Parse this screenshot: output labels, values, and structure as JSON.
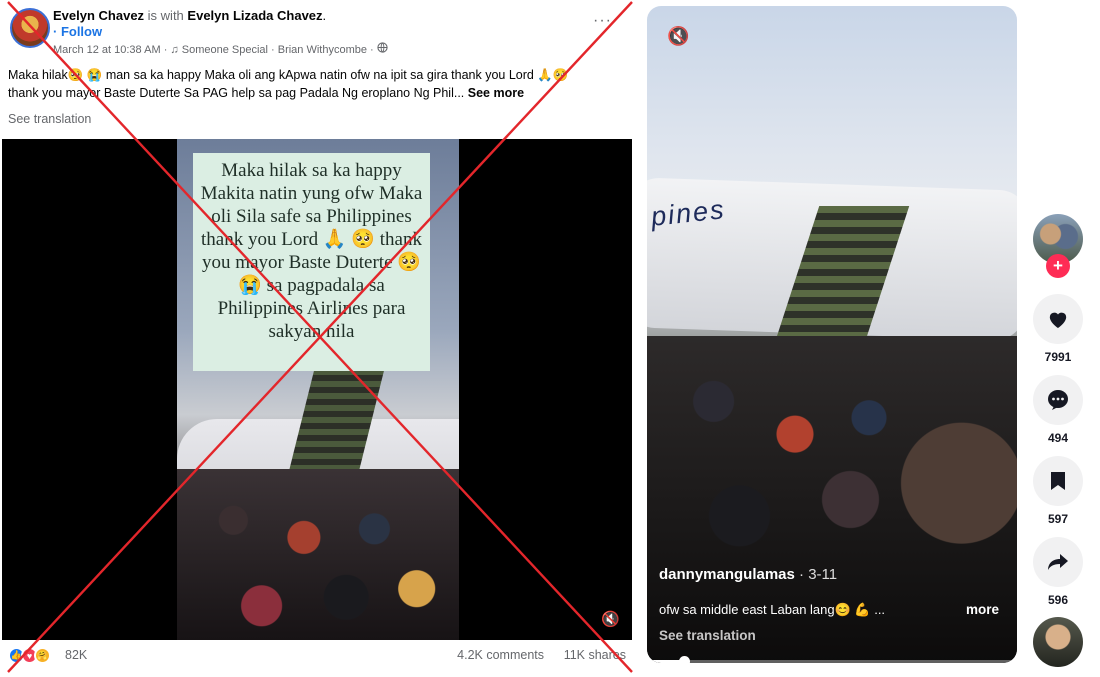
{
  "facebook_post": {
    "author": "Evelyn Chavez",
    "with_text": "is with",
    "tagged": "Evelyn Lizada Chavez",
    "tagged_suffix": ".",
    "follow": "· Follow",
    "timestamp": "March 12 at 10:38 AM",
    "meta_sep": "·",
    "audio": "Someone Special · Brian Withycombe",
    "privacy_icon": "globe-icon",
    "more_icon": "···",
    "caption_line1": "Maka hilak🥺 😭 man sa ka happy Maka oli ang kApwa natin ofw na ipit sa gira thank you Lord 🙏🥺",
    "caption_line2": "thank you mayor Baste Duterte Sa PAG help sa pag Padala Ng eroplano Ng Phil...",
    "see_more": "See more",
    "see_translation": "See translation",
    "video_overlay_text": "Maka hilak sa ka happy Makita natin yung ofw Maka oli Sila safe sa Philippines thank you Lord 🙏 🥺  thank you mayor Baste Duterte 🥺😭 sa pagpadala  sa Philippines Airlines para sakyan nila",
    "mute_icon": "🔇",
    "reactions": [
      "like",
      "love",
      "care"
    ],
    "reaction_count": "82K",
    "comments": "4.2K comments",
    "shares": "11K shares",
    "false_mark_color": "#e3262b"
  },
  "tiktok": {
    "mute_icon": "🔇",
    "airline_text": "pines",
    "username": "dannymangulamas",
    "date": " · 3-11",
    "caption": "ofw sa middle east Laban lang😊 💪 ...",
    "more": "more",
    "see_translation": "See translation",
    "progress": 0.1,
    "follow_plus": "+",
    "likes": "7991",
    "comments": "494",
    "saves": "597",
    "shares": "596",
    "accent": "#fe2c55"
  }
}
